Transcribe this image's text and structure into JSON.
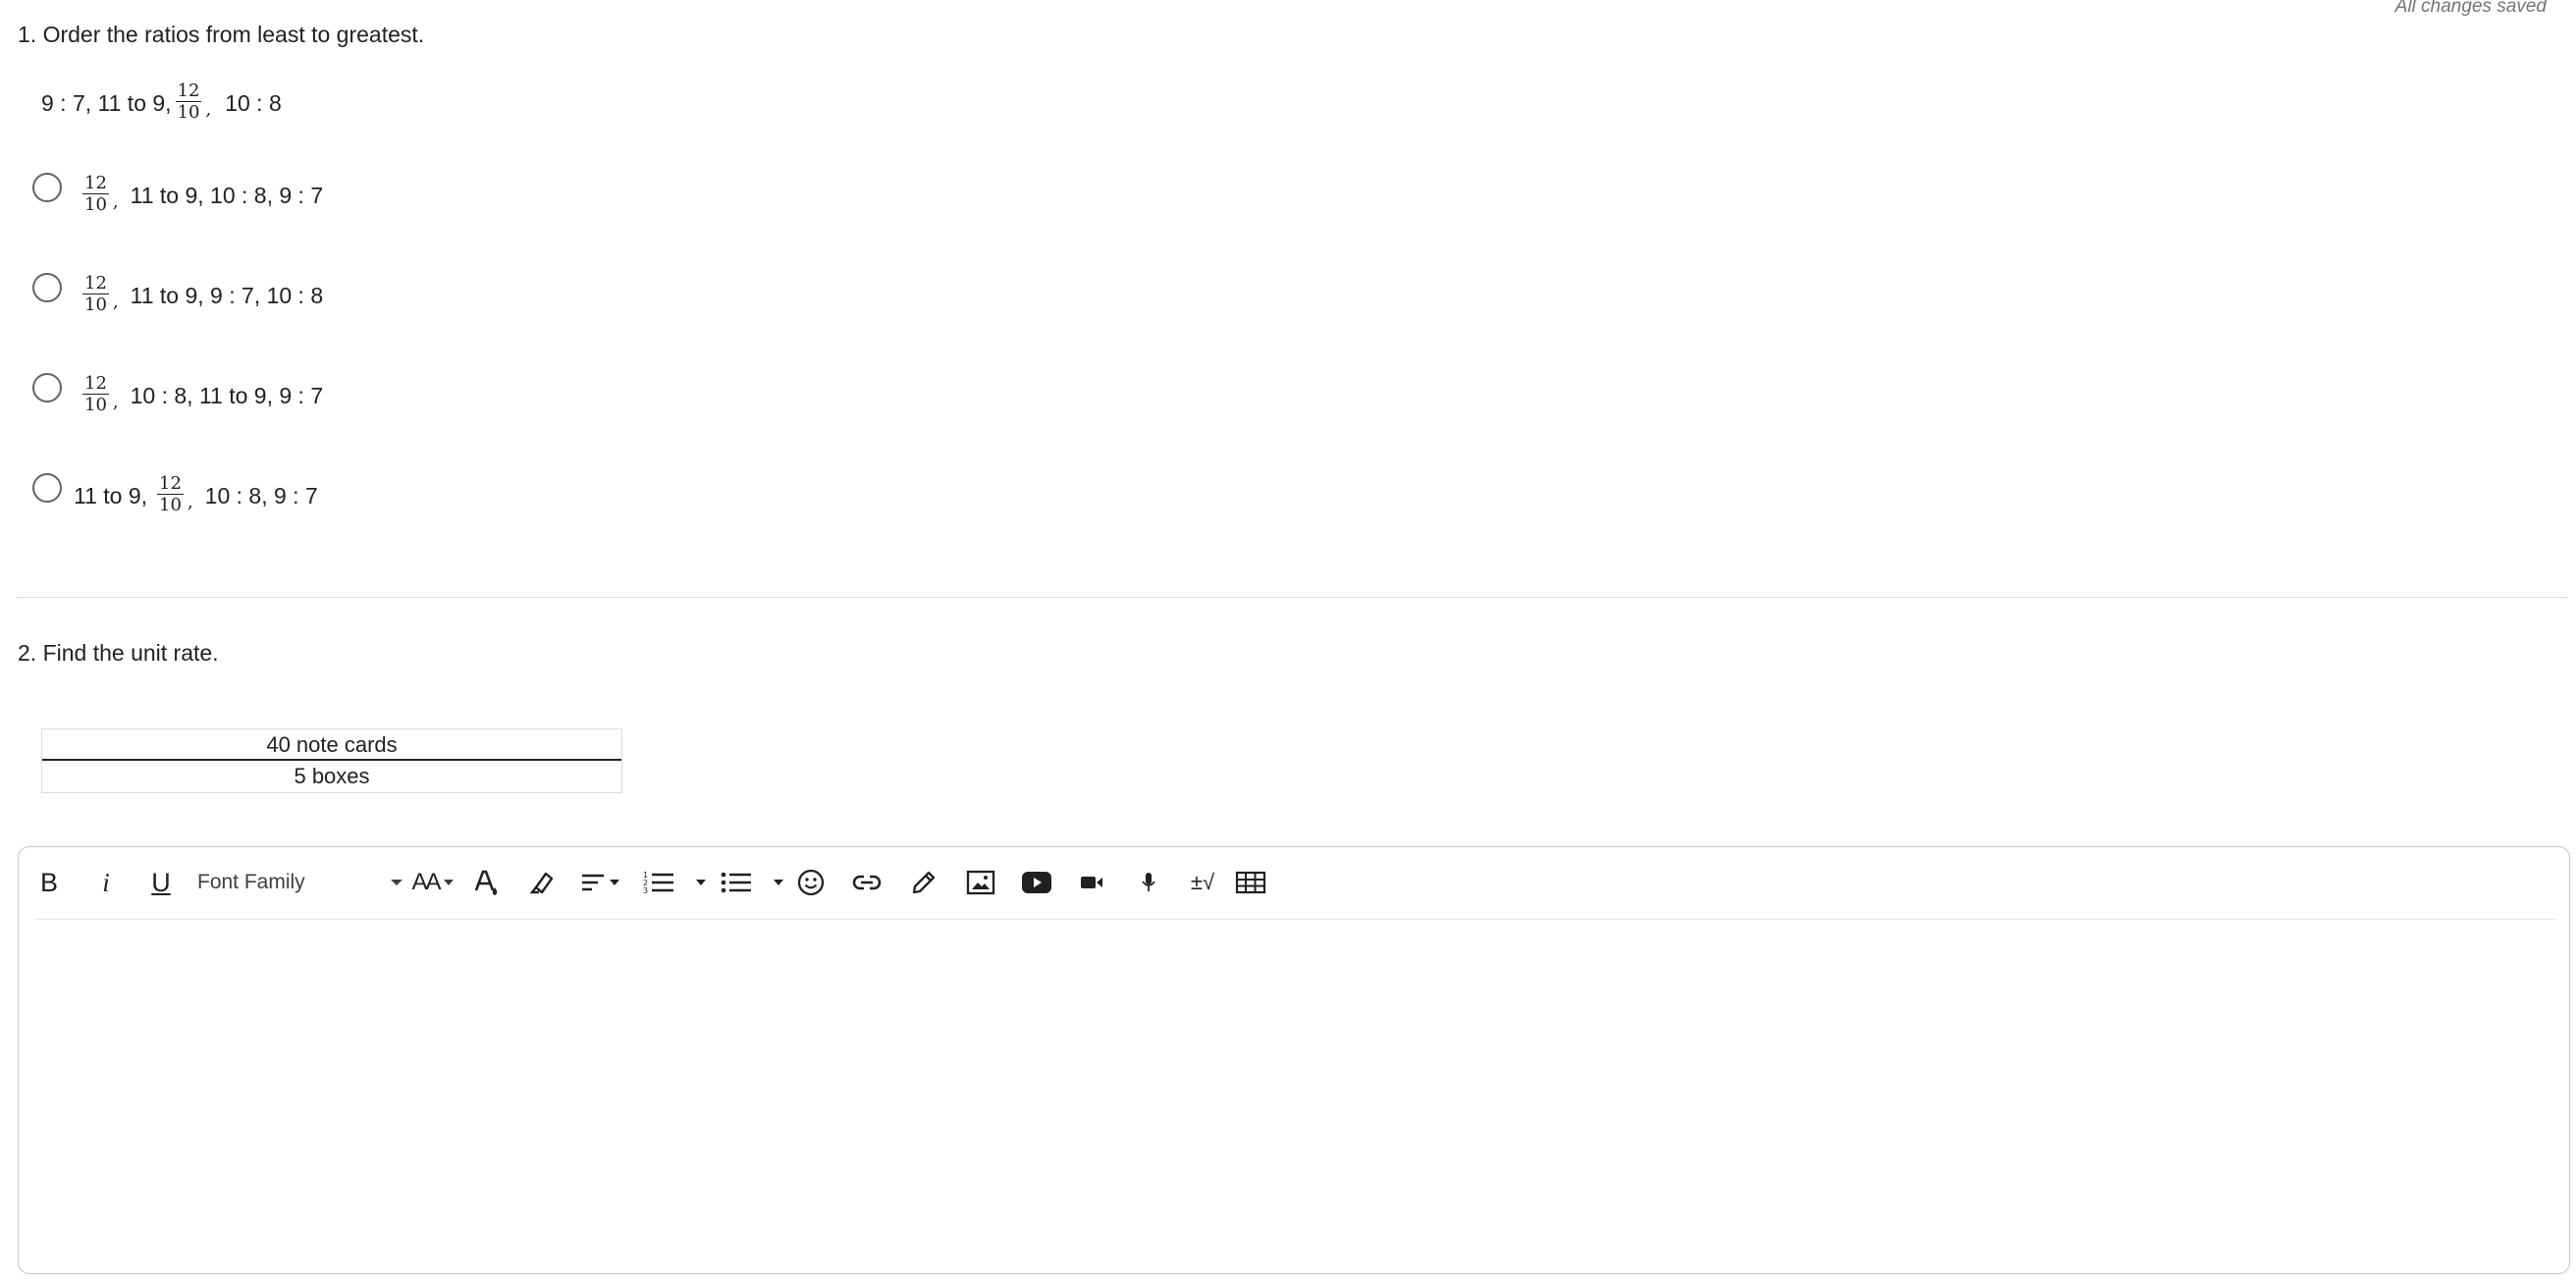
{
  "status": {
    "saved_text": "All changes saved"
  },
  "question1": {
    "title": "1. Order the ratios from least to greatest.",
    "prompt": {
      "part1": "9 : 7, 11 to 9,",
      "frac_num": "12",
      "frac_den": "10",
      "comma": ",",
      "part2": "10 : 8"
    },
    "options": [
      {
        "frac_num": "12",
        "frac_den": "10",
        "comma": ",",
        "text": "11 to 9, 10 : 8, 9 : 7"
      },
      {
        "frac_num": "12",
        "frac_den": "10",
        "comma": ",",
        "text": "11 to 9, 9 : 7, 10 : 8"
      },
      {
        "frac_num": "12",
        "frac_den": "10",
        "comma": ",",
        "text": "10 : 8, 11 to 9, 9 : 7"
      },
      {
        "prefix": "11 to 9,",
        "frac_num": "12",
        "frac_den": "10",
        "comma": ",",
        "text": "10 : 8, 9 : 7"
      }
    ]
  },
  "question2": {
    "title": "2. Find the unit rate.",
    "rate": {
      "numerator": "40 note cards",
      "denominator": "5 boxes"
    }
  },
  "editor": {
    "toolbar": {
      "bold": "B",
      "italic": "i",
      "underline": "U",
      "font_family": "Font Family",
      "font_size": "AA",
      "equation": "±√"
    }
  }
}
